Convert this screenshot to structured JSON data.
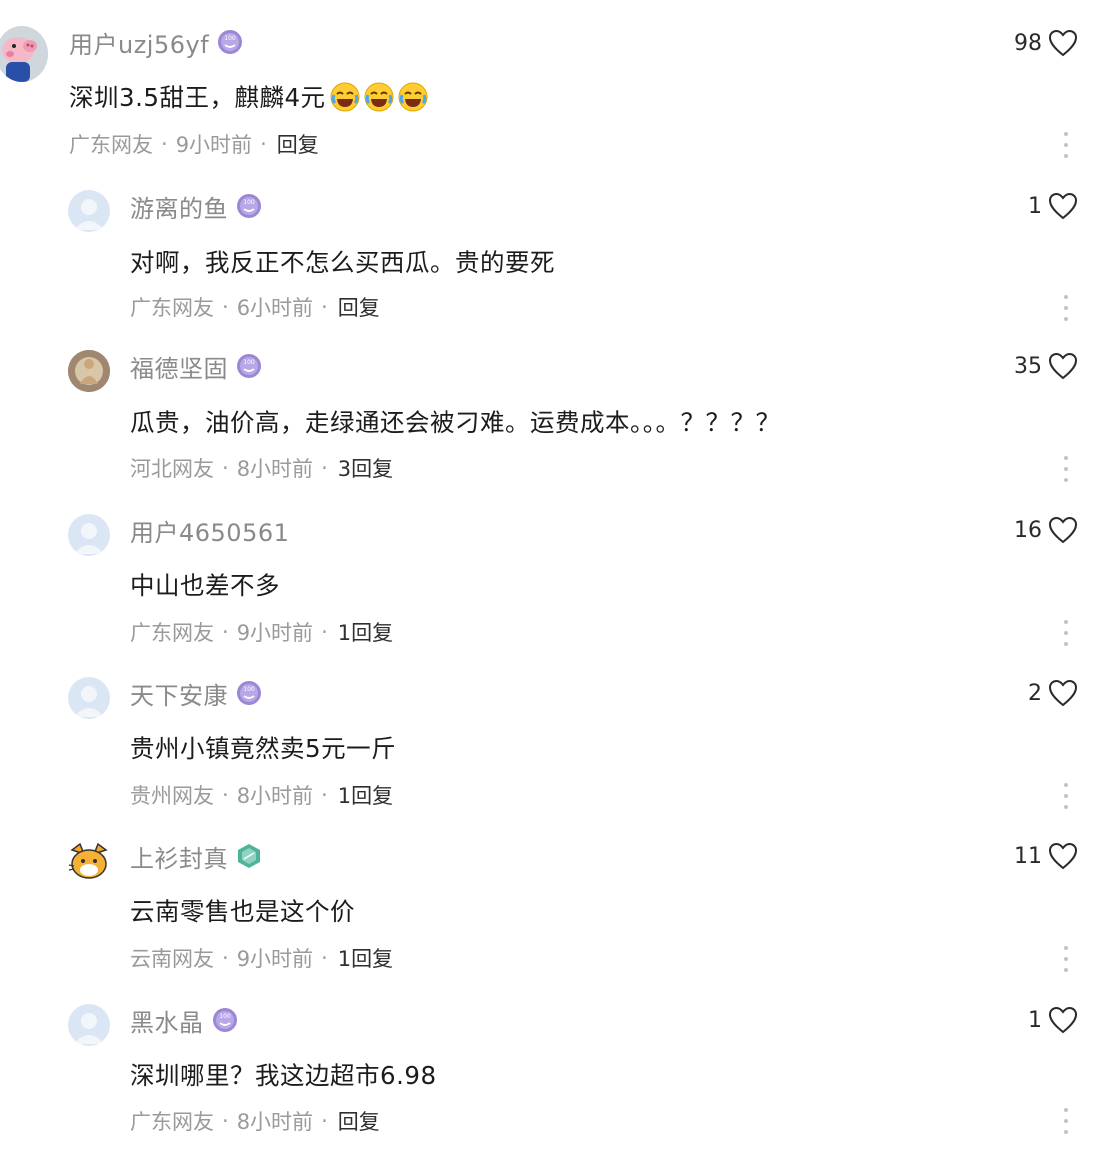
{
  "comments": [
    {
      "avatar": "peppa-pig-avatar",
      "username": "用户uzj56yf",
      "badge": "level-badge-purple",
      "text": "深圳3.5甜王，麒麟4元",
      "emojis": [
        "laugh-cry-emoji",
        "laugh-cry-emoji",
        "laugh-cry-emoji"
      ],
      "location": "广东网友",
      "time": "9小时前",
      "reply": "回复",
      "likes": "98"
    },
    {
      "avatar": "default-avatar",
      "username": "游离的鱼",
      "badge": "level-badge-purple",
      "text": "对啊，我反正不怎么买西瓜。贵的要死",
      "location": "广东网友",
      "time": "6小时前",
      "reply": "回复",
      "likes": "1"
    },
    {
      "avatar": "buddha-statue-avatar",
      "username": "福德坚固",
      "badge": "level-badge-purple",
      "text": "瓜贵，油价高，走绿通还会被刁难。运费成本。。。？？？？",
      "location": "河北网友",
      "time": "8小时前",
      "reply": "3回复",
      "likes": "35"
    },
    {
      "avatar": "default-avatar",
      "username": "用户4650561",
      "text": "中山也差不多",
      "location": "广东网友",
      "time": "9小时前",
      "reply": "1回复",
      "likes": "16"
    },
    {
      "avatar": "default-avatar",
      "username": "天下安康",
      "badge": "level-badge-purple",
      "text": "贵州小镇竟然卖5元一斤",
      "location": "贵州网友",
      "time": "8小时前",
      "reply": "1回复",
      "likes": "2"
    },
    {
      "avatar": "cartoon-cat-avatar",
      "username": "上衫封真",
      "badge": "level-badge-green",
      "text": "云南零售也是这个价",
      "location": "云南网友",
      "time": "9小时前",
      "reply": "1回复",
      "likes": "11"
    },
    {
      "avatar": "default-avatar",
      "username": "黑水晶",
      "badge": "level-badge-purple",
      "text": "深圳哪里？我这边超市6.98",
      "location": "广东网友",
      "time": "8小时前",
      "reply": "回复",
      "likes": "1"
    }
  ],
  "meta_separator": "·",
  "colors": {
    "username": "#8a8a8a",
    "body_text": "#1c1c1c",
    "meta": "#9a9a9a",
    "badge_purple": "#9b87d6",
    "badge_green": "#4fb39a"
  }
}
